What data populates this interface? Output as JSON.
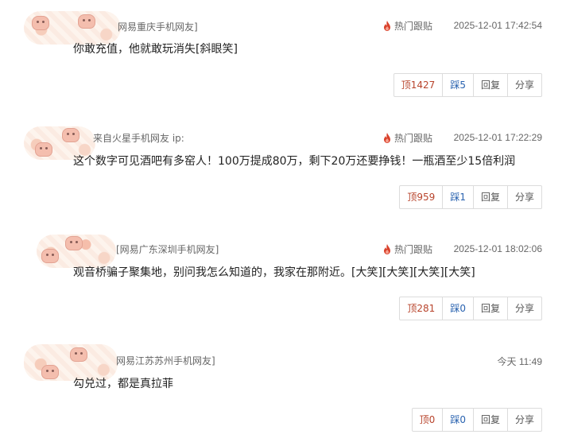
{
  "comments": [
    {
      "user": "网易重庆手机网友]",
      "hot_label": "热门跟贴",
      "time": "2025-12-01 17:42:54",
      "text": "你敢充值，他就敢玩消失[斜眼笑]",
      "up_label": "顶",
      "up_count": "1427",
      "down_label": "踩",
      "down_count": "5",
      "reply": "回复",
      "share": "分享"
    },
    {
      "user": "来自火星手机网友 ip:",
      "hot_label": "热门跟贴",
      "time": "2025-12-01 17:22:29",
      "text": "这个数字可见酒吧有多窑人！100万提成80万，剩下20万还要挣钱！一瓶酒至少15倍利润",
      "up_label": "顶",
      "up_count": "959",
      "down_label": "踩",
      "down_count": "1",
      "reply": "回复",
      "share": "分享"
    },
    {
      "user": "[网易广东深圳手机网友]",
      "hot_label": "热门跟贴",
      "time": "2025-12-01 18:02:06",
      "text": "观音桥骗子聚集地，别问我怎么知道的，我家在那附近。[大笑][大笑][大笑][大笑]",
      "up_label": "顶",
      "up_count": "281",
      "down_label": "踩",
      "down_count": "0",
      "reply": "回复",
      "share": "分享"
    },
    {
      "user": "网易江苏苏州手机网友]",
      "hot_label": "",
      "time": "今天 11:49",
      "text": "勾兑过，都是真拉菲",
      "up_label": "顶",
      "up_count": "0",
      "down_label": "踩",
      "down_count": "0",
      "reply": "回复",
      "share": "分享"
    }
  ],
  "colors": {
    "hot_flame": "#d9412b",
    "up": "#b8442c",
    "down": "#2a63b0"
  },
  "icons": [
    "flame-icon"
  ]
}
